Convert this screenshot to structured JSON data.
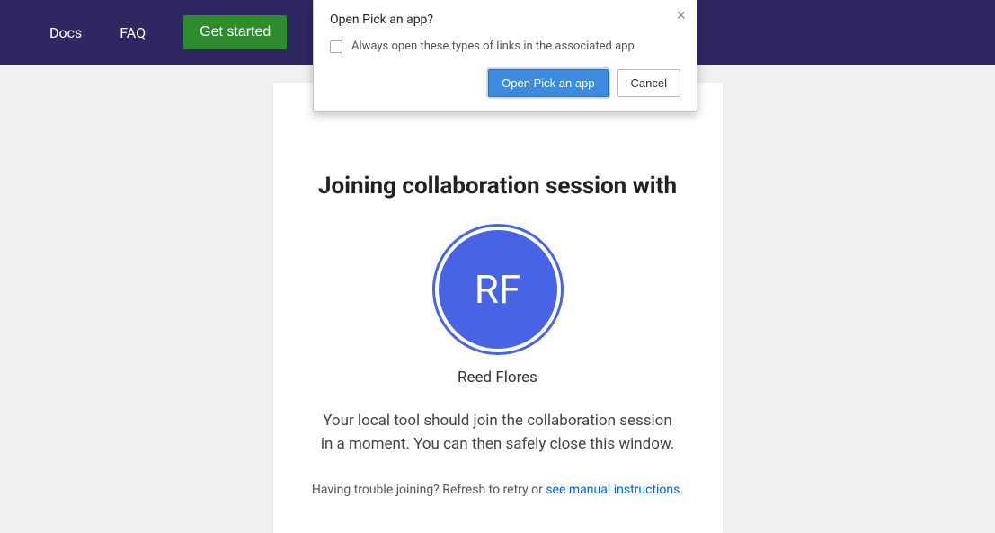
{
  "nav": {
    "docs": "Docs",
    "faq": "FAQ",
    "get_started": "Get started"
  },
  "dialog": {
    "title": "Open Pick an app?",
    "checkbox_label": "Always open these types of links in the associated app",
    "open_btn": "Open Pick an app",
    "cancel_btn": "Cancel"
  },
  "session": {
    "title": "Joining collaboration session with",
    "avatar_initials": "RF",
    "user_name": "Reed Flores",
    "description": "Your local tool should join the collaboration session in a moment. You can then safely close this window.",
    "trouble_prefix": "Having trouble joining? Refresh to retry or ",
    "trouble_link": "see manual instructions",
    "trouble_suffix": "."
  }
}
